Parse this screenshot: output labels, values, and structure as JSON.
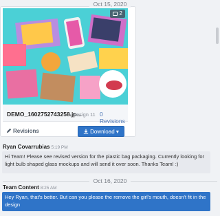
{
  "dates": {
    "first": "Oct 15, 2020",
    "second": "Oct 16, 2020"
  },
  "attachment": {
    "comment_count": "2",
    "file_name": "DEMO_1602752743258.jp...",
    "design": "- Design 11",
    "revisions_count": "0 Revisions",
    "revisions_link": "Revisions",
    "download_label": "Download"
  },
  "messages": [
    {
      "author": "Ryan Covarrubias",
      "time": "5:19 PM",
      "text": "Hi Team! Please see revised version for the plastic bag packaging. Currently looking for light bulb shaped glass mockups and will send it over soon. Thanks Team! :)"
    },
    {
      "author": "Team Content",
      "time": "8:25 AM",
      "text": "Hey Ryan, that's better. But can you please the remove the girl's mouth, doesn't fit in the design"
    }
  ],
  "colors": {
    "accent": "#2f74c8",
    "thumb_bg": "#4bd0d6"
  }
}
